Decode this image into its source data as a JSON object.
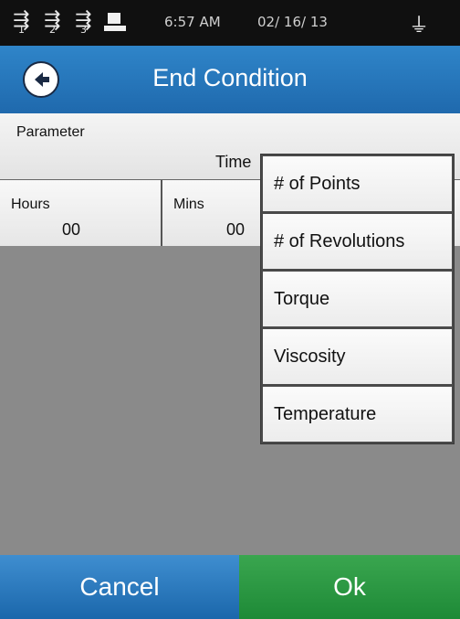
{
  "status_bar": {
    "usb_ports": [
      {
        "icon": "usb-icon",
        "number": "1"
      },
      {
        "icon": "usb-icon",
        "number": "2"
      },
      {
        "icon": "usb-icon",
        "number": "3"
      }
    ],
    "printer_icon": "printer-icon",
    "time": "6:57 AM",
    "date": "02/ 16/ 13",
    "probe_icon": "temperature-probe-icon"
  },
  "header": {
    "title": "End Condition",
    "back_icon": "back-arrow-icon"
  },
  "parameter": {
    "label": "Parameter",
    "value": "Time"
  },
  "fields": [
    {
      "label": "Hours",
      "value": "00"
    },
    {
      "label": "Mins",
      "value": "00"
    }
  ],
  "dropdown": {
    "options": [
      "# of Points",
      "# of Revolutions",
      "Torque",
      "Viscosity",
      "Temperature"
    ]
  },
  "buttons": {
    "cancel_label": "Cancel",
    "ok_label": "Ok"
  },
  "colors": {
    "header_blue": "#2575bb",
    "ok_green": "#2a9a44",
    "background_gray": "#8a8a8a"
  }
}
